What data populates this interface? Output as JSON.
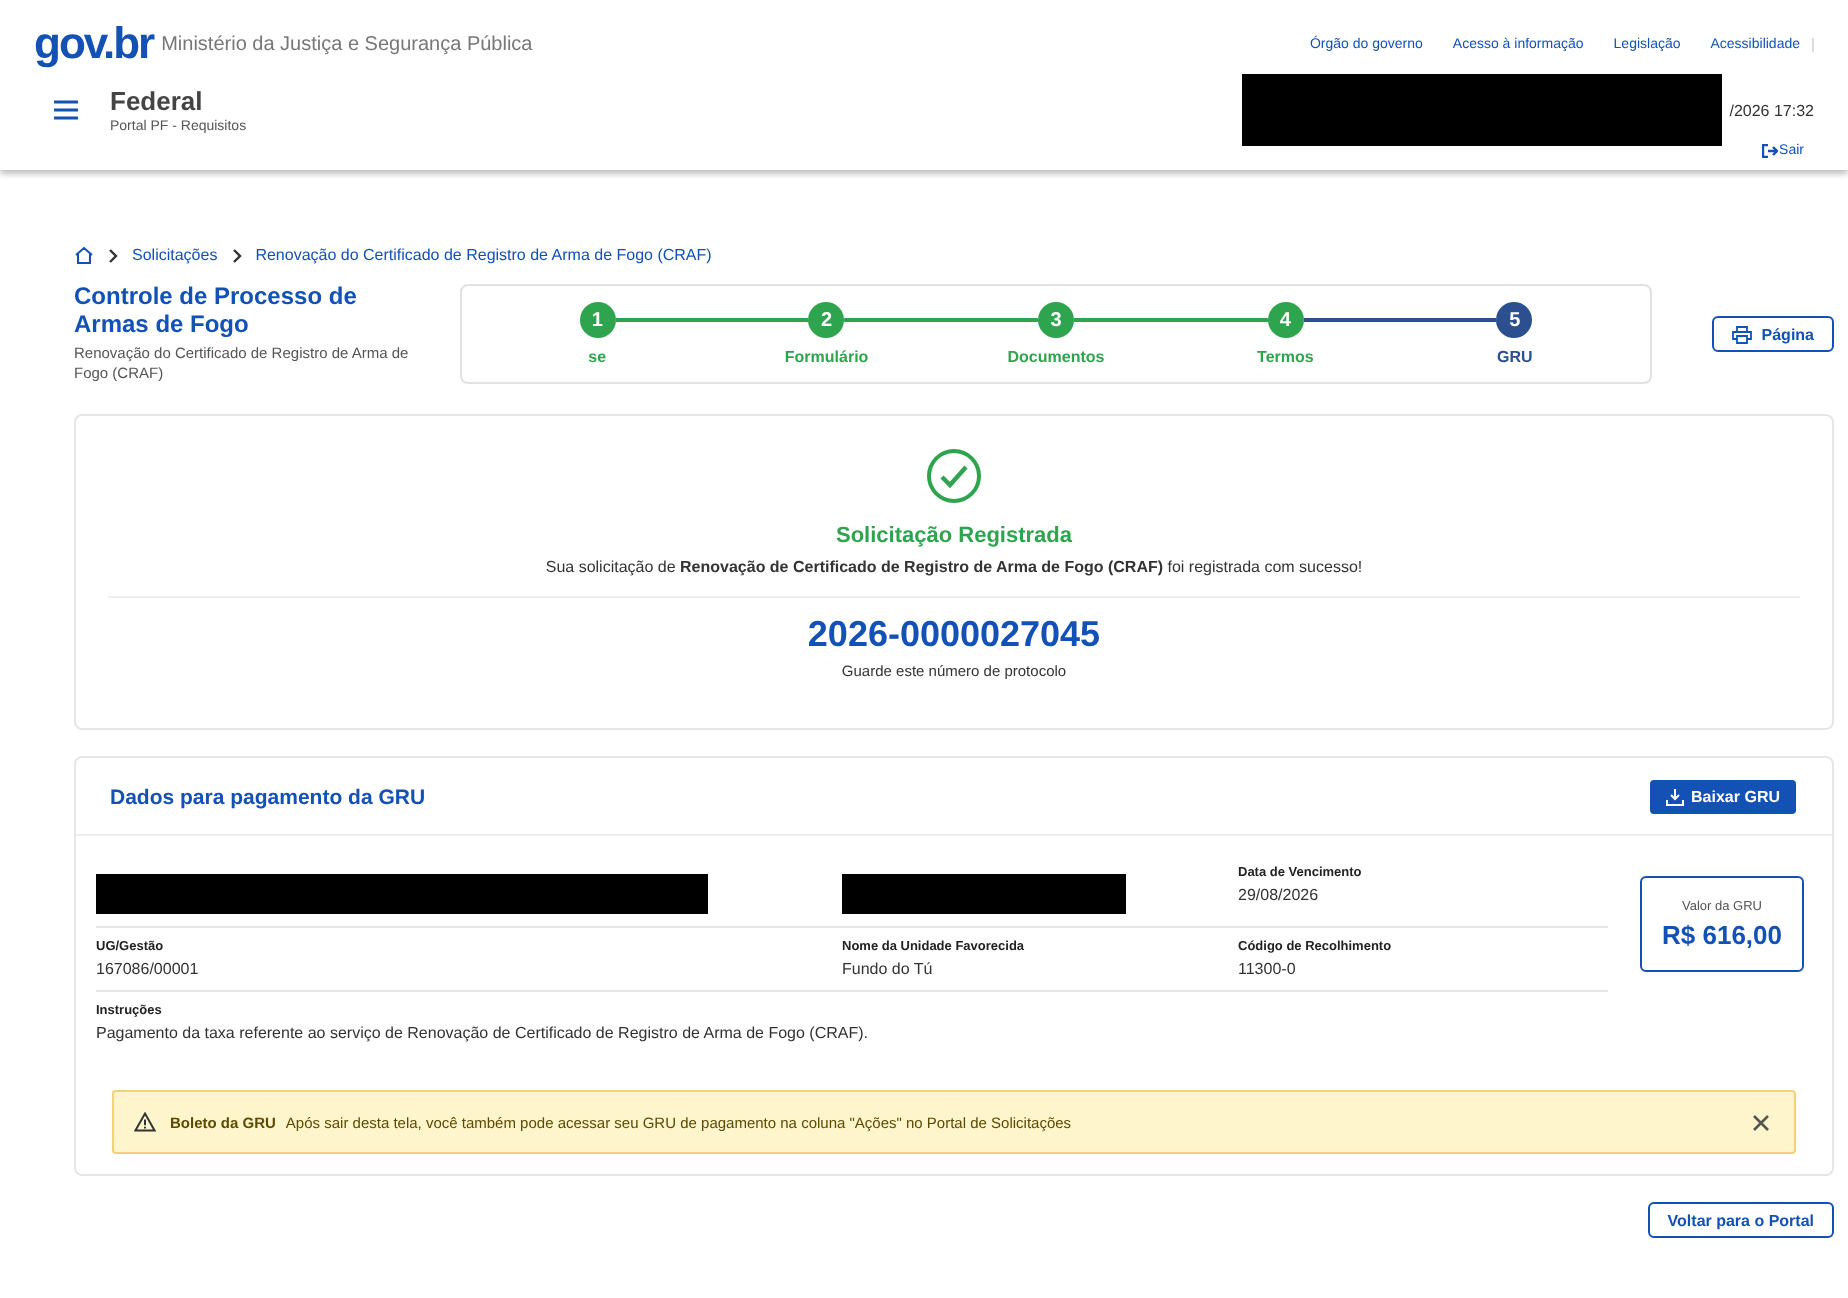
{
  "header": {
    "logo": "gov.br",
    "ministry": "Ministério da Justiça e Segurança Pública",
    "links": [
      "Órgão do governo",
      "Acesso à informação",
      "Legislação",
      "Acessibilidade"
    ],
    "title": "Federal",
    "subtitle": "Portal PF - Requisitos",
    "datetime": "/2026 17:32",
    "logout": "Sair"
  },
  "breadcrumb": [
    "Solicitações",
    "Renovação do Certificado de Registro de Arma de Fogo (CRAF)"
  ],
  "process": {
    "title": "Controle de Processo de Armas de Fogo",
    "subtitle": "Renovação do Certificado de Registro de Arma de Fogo (CRAF)"
  },
  "steps": [
    {
      "number": "1",
      "label": "se",
      "completed": true
    },
    {
      "number": "2",
      "label": "Formulário",
      "completed": true
    },
    {
      "number": "3",
      "label": "Documentos",
      "completed": true
    },
    {
      "number": "4",
      "label": "Termos",
      "completed": true
    },
    {
      "number": "5",
      "label": "GRU",
      "completed": false
    }
  ],
  "print_button": "Página",
  "success": {
    "title": "Solicitação Registrada",
    "message": "Sua solicitação de **Renovação de Certificado de Registro de Arma de Fogo (CRAF)** foi registrada com sucesso!",
    "protocol": "2026-0000027045",
    "protocol_hint": "Guarde este número de protocolo"
  },
  "payment": {
    "title": "Dados para pagamento da GRU",
    "download_button": "Baixar GRU",
    "fields": [
      {
        "kind": "redacted"
      },
      {
        "kind": "redacted"
      },
      {
        "kind": "field",
        "label": "Data de Vencimento",
        "value": "29/08/2026"
      },
      {
        "kind": "field",
        "label": "UG/Gestão",
        "value": "167086/00001"
      },
      {
        "kind": "field",
        "label": "Nome da Unidade Favorecida",
        "value": "Fundo do Tú"
      },
      {
        "kind": "field",
        "label": "Código de Recolhimento",
        "value": "11300-0"
      }
    ],
    "instructions_label": "Instruções",
    "instructions": "Pagamento da taxa referente ao serviço de Renovação de Certificado de Registro de Arma de Fogo (CRAF).",
    "total_label": "Valor da GRU",
    "total": "R$ 616,00",
    "alert": {
      "title": "Boleto da GRU",
      "message": "Após sair desta tela, você também pode acessar seu GRU de pagamento na coluna \"Ações\" no Portal de Solicitações"
    }
  },
  "back_button": "Voltar para o Portal"
}
